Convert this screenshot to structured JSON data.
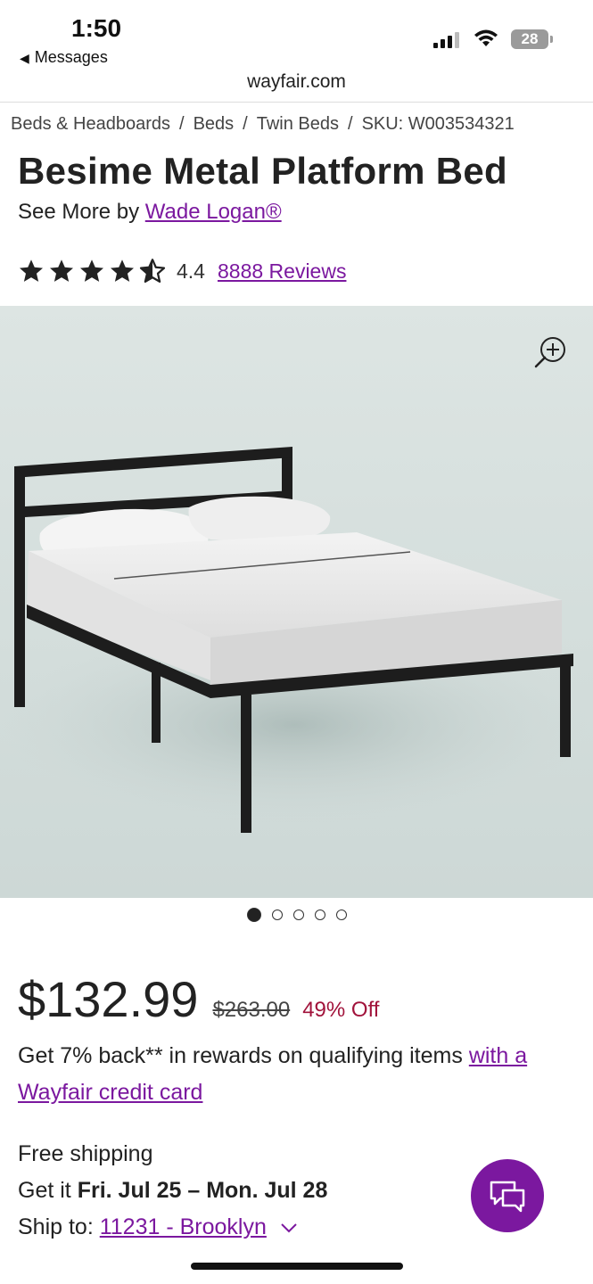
{
  "status_bar": {
    "time": "1:50",
    "back_app": "Messages",
    "battery": "28"
  },
  "browser": {
    "url": "wayfair.com"
  },
  "breadcrumbs": [
    "Beds & Headboards",
    "Beds",
    "Twin Beds",
    "SKU: W003534321"
  ],
  "product": {
    "title": "Besime Metal Platform Bed",
    "see_more_prefix": "See More by",
    "brand": "Wade Logan®",
    "rating": "4.4",
    "rating_value": 4.4,
    "reviews": "8888 Reviews"
  },
  "gallery": {
    "image_count": 5,
    "active_index": 0,
    "zoom_icon": "zoom-in-icon"
  },
  "pricing": {
    "price": "$132.99",
    "original_price": "$263.00",
    "discount": "49% Off",
    "rewards_text": "Get 7% back** in rewards on qualifying items",
    "rewards_link": "with a Wayfair credit card"
  },
  "shipping": {
    "free_shipping": "Free shipping",
    "get_it_prefix": "Get it",
    "delivery_range": "Fri. Jul 25 – Mon. Jul 28",
    "ship_to_prefix": "Ship to:",
    "location": "11231 - Brooklyn"
  },
  "colors": {
    "accent": "#7b189f",
    "discount": "#a1133b"
  }
}
